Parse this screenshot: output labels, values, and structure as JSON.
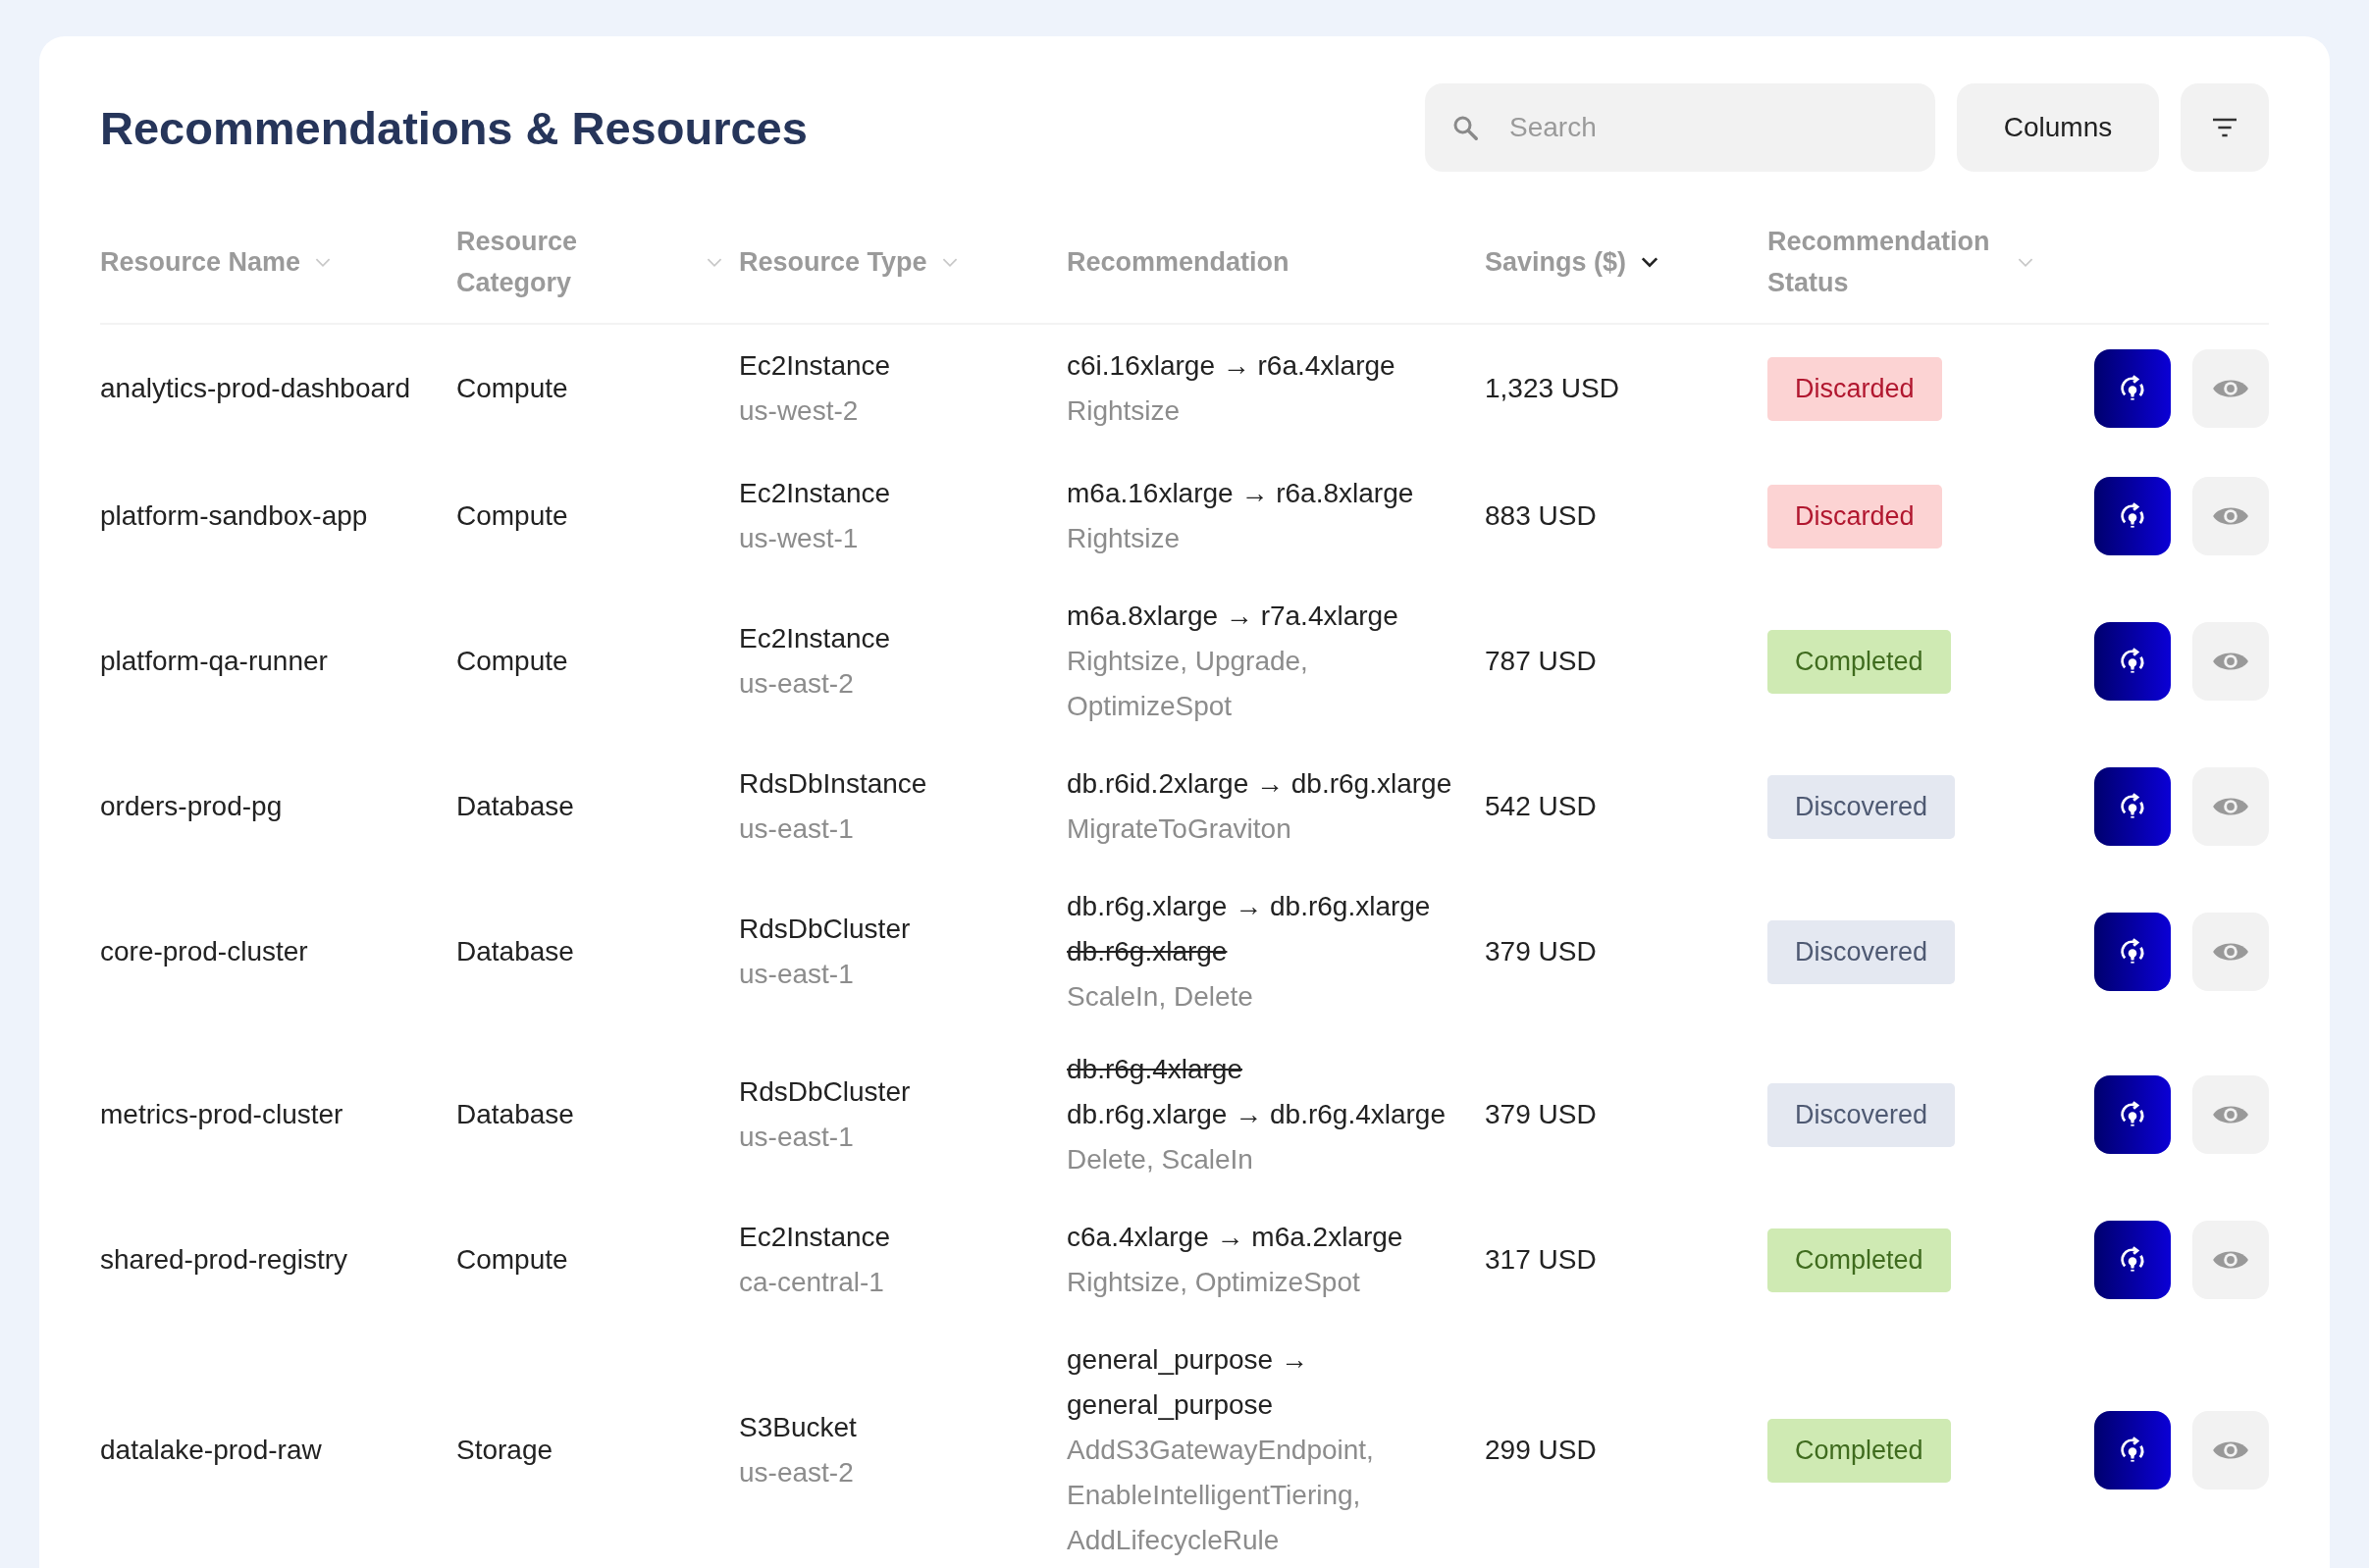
{
  "title": "Recommendations & Resources",
  "search": {
    "placeholder": "Search"
  },
  "columns_button": "Columns",
  "columns": [
    {
      "label": "Resource Name",
      "sortable": true,
      "sorted": false
    },
    {
      "label": "Resource Category",
      "sortable": true,
      "sorted": false
    },
    {
      "label": "Resource Type",
      "sortable": true,
      "sorted": false
    },
    {
      "label": "Recommendation",
      "sortable": false
    },
    {
      "label": "Savings ($)",
      "sortable": true,
      "sorted": true
    },
    {
      "label": "Recommendation Status",
      "sortable": true,
      "sorted": false
    }
  ],
  "rows": [
    {
      "name": "analytics-prod-dashboard",
      "category": "Compute",
      "type": "Ec2Instance",
      "region": "us-west-2",
      "recommendation": [
        {
          "text": "c6i.16xlarge → r6a.4xlarge",
          "struck": false
        }
      ],
      "actions": "Rightsize",
      "savings": "1,323 USD",
      "status": {
        "label": "Discarded",
        "kind": "discarded"
      }
    },
    {
      "name": "platform-sandbox-app",
      "category": "Compute",
      "type": "Ec2Instance",
      "region": "us-west-1",
      "recommendation": [
        {
          "text": "m6a.16xlarge → r6a.8xlarge",
          "struck": false
        }
      ],
      "actions": "Rightsize",
      "savings": "883 USD",
      "status": {
        "label": "Discarded",
        "kind": "discarded"
      }
    },
    {
      "name": "platform-qa-runner",
      "category": "Compute",
      "type": "Ec2Instance",
      "region": "us-east-2",
      "recommendation": [
        {
          "text": "m6a.8xlarge → r7a.4xlarge",
          "struck": false
        }
      ],
      "actions": "Rightsize, Upgrade, OptimizeSpot",
      "savings": "787 USD",
      "status": {
        "label": "Completed",
        "kind": "completed"
      }
    },
    {
      "name": "orders-prod-pg",
      "category": "Database",
      "type": "RdsDbInstance",
      "region": "us-east-1",
      "recommendation": [
        {
          "text": "db.r6id.2xlarge → db.r6g.xlarge",
          "struck": false
        }
      ],
      "actions": "MigrateToGraviton",
      "savings": "542 USD",
      "status": {
        "label": "Discovered",
        "kind": "discovered"
      }
    },
    {
      "name": "core-prod-cluster",
      "category": "Database",
      "type": "RdsDbCluster",
      "region": "us-east-1",
      "recommendation": [
        {
          "text": "db.r6g.xlarge → db.r6g.xlarge",
          "struck": false
        },
        {
          "text": "db.r6g.xlarge",
          "struck": true
        }
      ],
      "actions": "ScaleIn, Delete",
      "savings": "379 USD",
      "status": {
        "label": "Discovered",
        "kind": "discovered"
      }
    },
    {
      "name": "metrics-prod-cluster",
      "category": "Database",
      "type": "RdsDbCluster",
      "region": "us-east-1",
      "recommendation": [
        {
          "text": "db.r6g.4xlarge",
          "struck": true
        },
        {
          "text": "db.r6g.xlarge → db.r6g.4xlarge",
          "struck": false
        }
      ],
      "actions": "Delete, ScaleIn",
      "savings": "379 USD",
      "status": {
        "label": "Discovered",
        "kind": "discovered"
      }
    },
    {
      "name": "shared-prod-registry",
      "category": "Compute",
      "type": "Ec2Instance",
      "region": "ca-central-1",
      "recommendation": [
        {
          "text": "c6a.4xlarge → m6a.2xlarge",
          "struck": false
        }
      ],
      "actions": "Rightsize, OptimizeSpot",
      "savings": "317 USD",
      "status": {
        "label": "Completed",
        "kind": "completed"
      }
    },
    {
      "name": "datalake-prod-raw",
      "category": "Storage",
      "type": "S3Bucket",
      "region": "us-east-2",
      "recommendation": [
        {
          "text": "general_purpose → general_purpose",
          "struck": false
        }
      ],
      "actions": "AddS3GatewayEndpoint, EnableIntelligentTiering, AddLifecycleRule",
      "savings": "299 USD",
      "status": {
        "label": "Completed",
        "kind": "completed"
      }
    }
  ]
}
